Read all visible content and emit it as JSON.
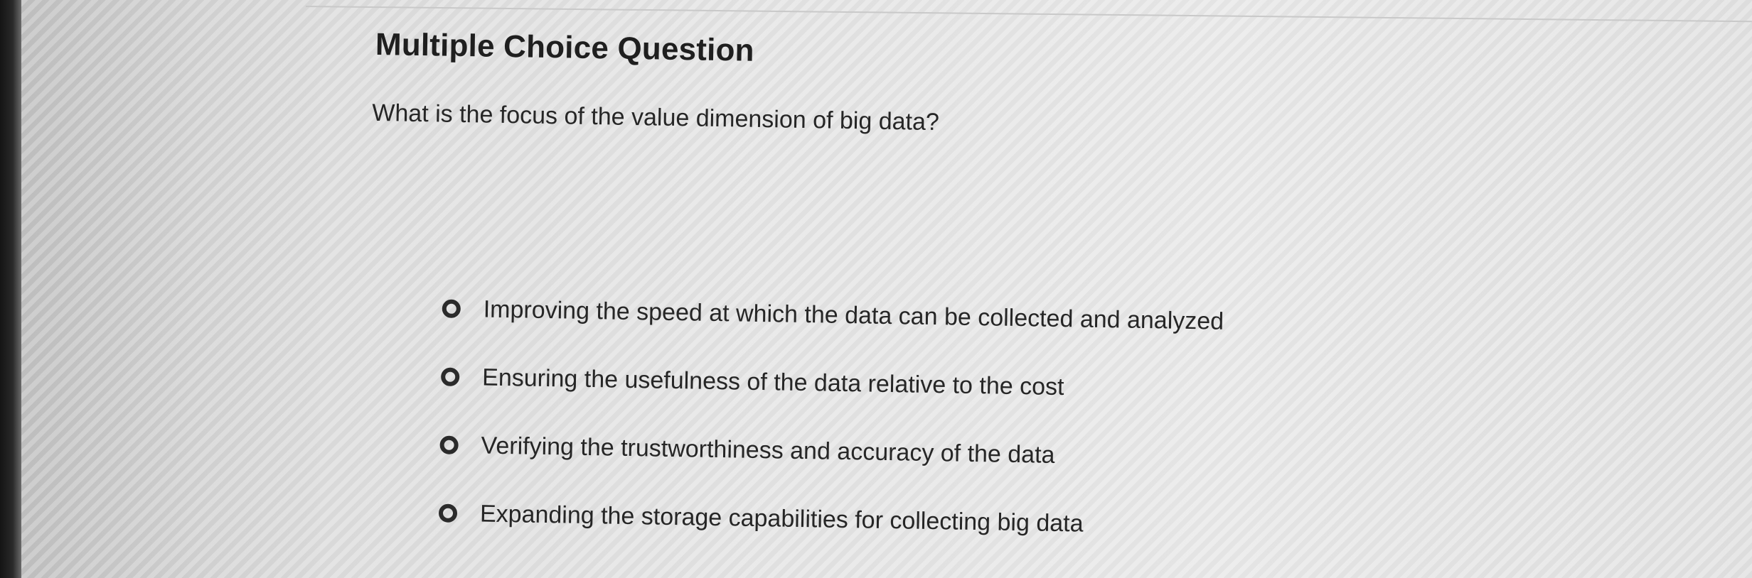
{
  "question": {
    "heading": "Multiple Choice Question",
    "prompt": "What is the focus of the value dimension of big data?",
    "options": [
      {
        "label": "Improving the speed at which the data can be collected and analyzed",
        "selected": false
      },
      {
        "label": "Ensuring the usefulness of the data relative to the cost",
        "selected": false
      },
      {
        "label": "Verifying the trustworthiness and accuracy of the data",
        "selected": false
      },
      {
        "label": "Expanding the storage capabilities for collecting big data",
        "selected": false
      }
    ]
  },
  "icons": {
    "radio": "radio-unselected-icon"
  }
}
